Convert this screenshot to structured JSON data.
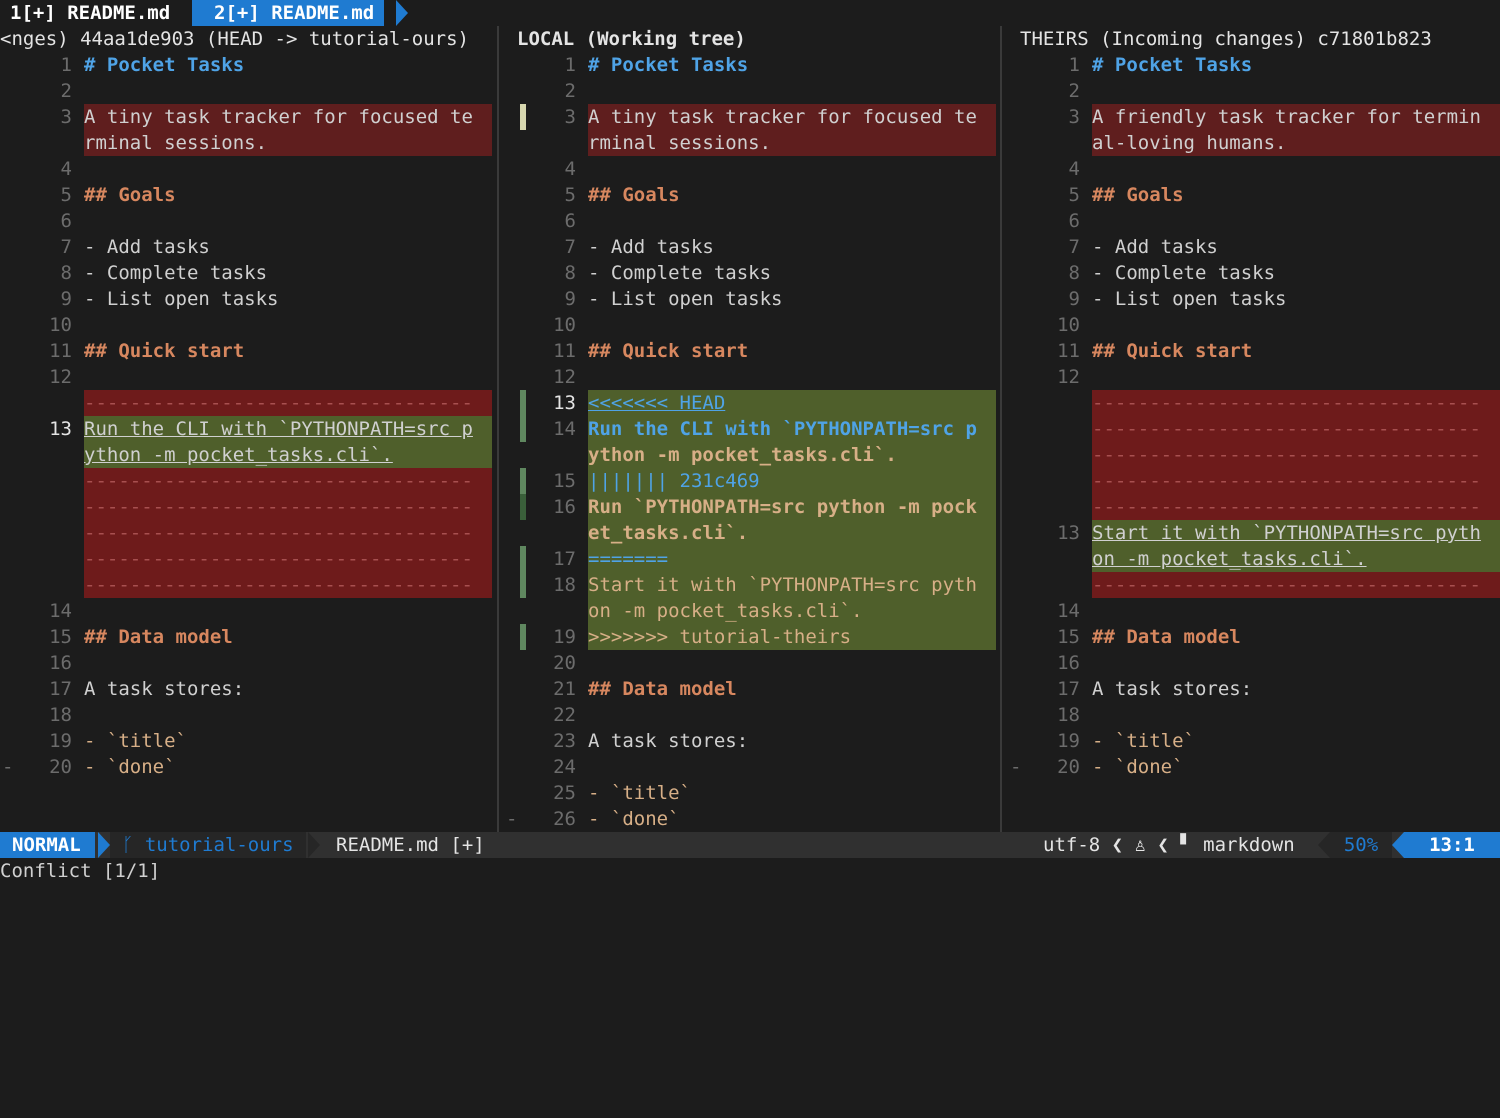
{
  "tabs": [
    {
      "label": "1[+] README.md",
      "active": false
    },
    {
      "label": "2[+] README.md",
      "active": true
    }
  ],
  "panes": {
    "left": {
      "header": "<nges) 44aa1de903 (HEAD -> tutorial-ours)",
      "l1": "# Pocket Tasks",
      "l3a": "A tiny task tracker for focused te",
      "l3b": "rminal sessions.",
      "l5": "## Goals",
      "l7": "- Add tasks",
      "l8": "- Complete tasks",
      "l9": "- List open tasks",
      "l11": "## Quick start",
      "l13a": "Run the CLI with `PYTHONPATH=src p",
      "l13b": "ython -m pocket_tasks.cli`.",
      "l15": "## Data model",
      "l17": "A task stores:",
      "l19": "- `title`",
      "l20": "- `done`"
    },
    "middle": {
      "header": "LOCAL (Working tree)",
      "l1": "# Pocket Tasks",
      "l3a": "A tiny task tracker for focused te",
      "l3b": "rminal sessions.",
      "l5": "## Goals",
      "l7": "- Add tasks",
      "l8": "- Complete tasks",
      "l9": "- List open tasks",
      "l11": "## Quick start",
      "l13": "<<<<<<< HEAD",
      "l14a": "Run the CLI with `PYTHONPATH=src p",
      "l14b": "ython -m pocket_tasks.cli`.",
      "l15": "||||||| 231c469",
      "l16a": "Run `PYTHONPATH=src python -m pock",
      "l16b": "et_tasks.cli`.",
      "l17": "=======",
      "l18a": "Start it with `PYTHONPATH=src pyth",
      "l18b": "on -m pocket_tasks.cli`.",
      "l19": ">>>>>>> tutorial-theirs",
      "l21": "## Data model",
      "l23": "A task stores:",
      "l25": "- `title`",
      "l26": "- `done`"
    },
    "right": {
      "header": "THEIRS (Incoming changes) c71801b823",
      "l1": "# Pocket Tasks",
      "l3a": "A friendly task tracker for termin",
      "l3b": "al-loving humans.",
      "l5": "## Goals",
      "l7": "- Add tasks",
      "l8": "- Complete tasks",
      "l9": "- List open tasks",
      "l11": "## Quick start",
      "l13a": "Start it with `PYTHONPATH=src pyth",
      "l13b": "on -m pocket_tasks.cli`.",
      "l15": "## Data model",
      "l17": "A task stores:",
      "l19": "- `title`",
      "l20": "- `done`"
    }
  },
  "filler": "----------------------------------",
  "statusline": {
    "mode": "NORMAL",
    "branch": "ᚴ tutorial-ours",
    "file": "README.md [+]",
    "encoding": "utf-8 ❮ ♙ ❮ ▘ markdown",
    "percent": "50%",
    "position": "13:1"
  },
  "cmdline": "Conflict [1/1]"
}
